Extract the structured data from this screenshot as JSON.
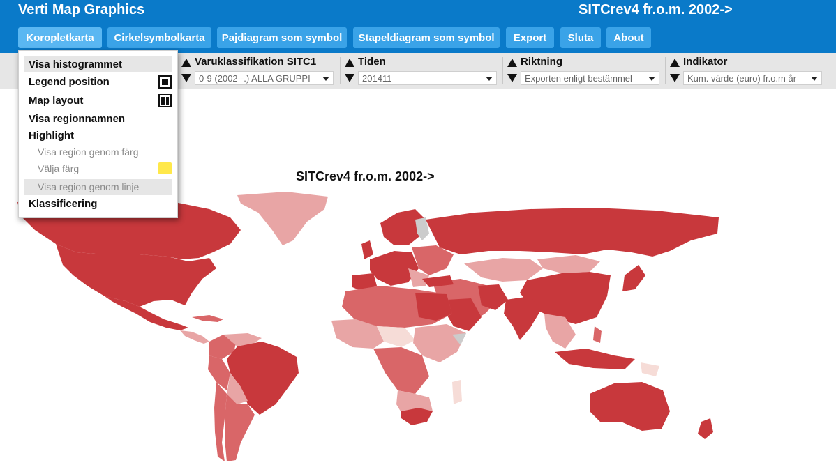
{
  "header": {
    "title": "Verti Map Graphics",
    "subtitle": "SITCrev4 fr.o.m. 2002->",
    "bg_color": "#0a7ac9"
  },
  "nav": {
    "items": [
      {
        "label": "Koropletkarta",
        "active": true
      },
      {
        "label": "Cirkelsymbolkarta"
      },
      {
        "label": "Pajdiagram som symbol"
      },
      {
        "label": "Stapeldiagram som symbol"
      },
      {
        "label": "Export"
      },
      {
        "label": "Sluta"
      },
      {
        "label": "About"
      }
    ],
    "button_color": "#3aa3e8",
    "active_color": "#5ab7f2"
  },
  "toolbar": {
    "varuklass": {
      "label": "Varuklassifikation SITC1",
      "value": "0-9 (2002--.) ALLA GRUPPI"
    },
    "tiden": {
      "label": "Tiden",
      "value": "201411"
    },
    "riktning": {
      "label": "Riktning",
      "value": "Exporten enligt bestämmel"
    },
    "indikator": {
      "label": "Indikator",
      "value": "Kum. värde (euro) fr.o.m år"
    }
  },
  "menu": {
    "visa_histogrammet": "Visa histogrammet",
    "legend_position": "Legend position",
    "map_layout": "Map layout",
    "visa_regionnamnen": "Visa regionnamnen",
    "highlight": "Highlight",
    "visa_region_farg": "Visa region genom färg",
    "valja_farg": "Välja färg",
    "visa_region_linje": "Visa region genom linje",
    "klassificering": "Klassificering",
    "highlight_color": "#ffe84a"
  },
  "map": {
    "title": "SITCrev4 fr.o.m. 2002->",
    "palette": {
      "dark": "#c8383c",
      "medium": "#d96668",
      "light": "#e8a5a5",
      "pale": "#f6dcd7",
      "no_data": "#cccccc"
    }
  }
}
